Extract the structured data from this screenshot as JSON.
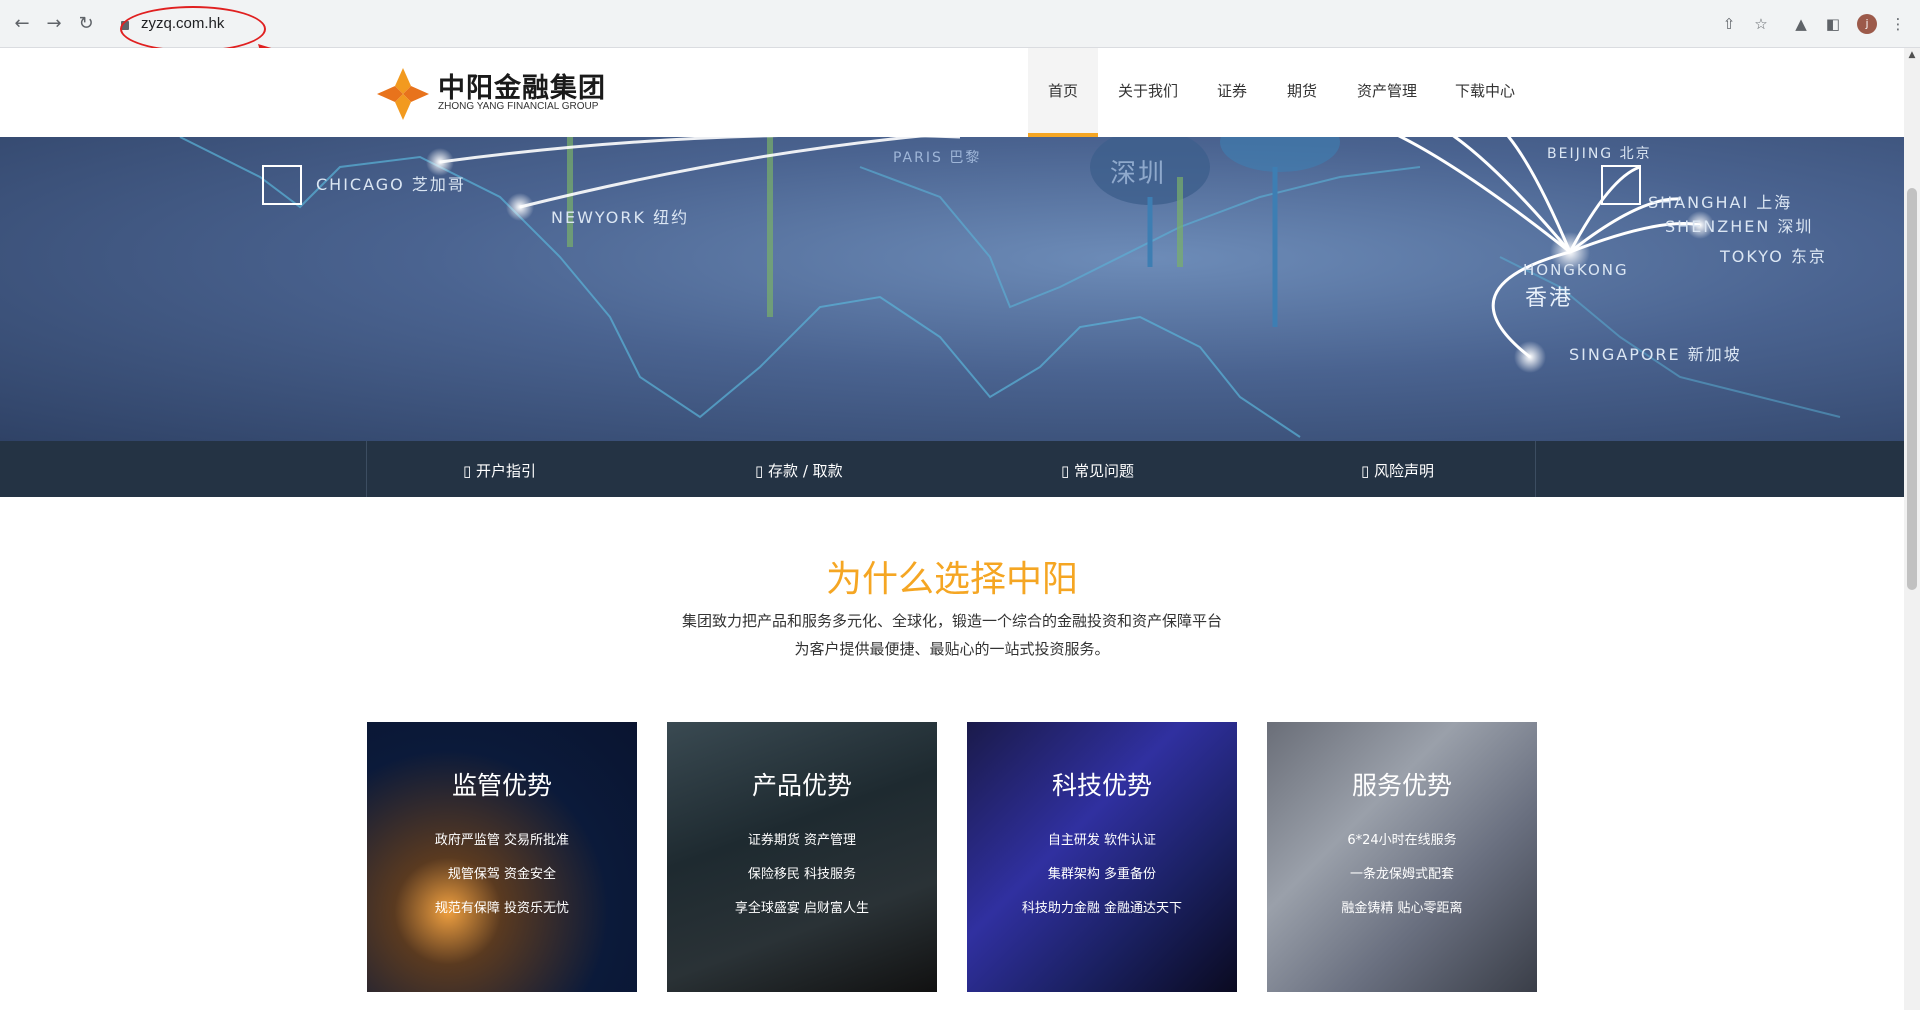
{
  "browser": {
    "url": "zyzq.com.hk",
    "avatar_letter": "j"
  },
  "site": {
    "logo_cn": "中阳金融集团",
    "logo_en": "ZHONG YANG FINANCIAL GROUP",
    "nav": [
      "首页",
      "关于我们",
      "证券",
      "期货",
      "资产管理",
      "下载中心"
    ],
    "accent": "#f5a623"
  },
  "hero": {
    "cities": {
      "chicago": "CHICAGO 芝加哥",
      "newyork": "NEWYORK 纽约",
      "paris": "PARIS 巴黎",
      "shenzhen_big": "深圳",
      "beijing": "BEIJING 北京",
      "shanghai": "SHANGHAI 上海",
      "shenzhen": "SHENZHEN 深圳",
      "tokyo": "TOKYO 东京",
      "hongkong": "HONGKONG",
      "hongkong_cn": "香港",
      "singapore": "SINGAPORE 新加坡"
    },
    "prev_glyph": "",
    "next_glyph": ""
  },
  "quicklinks": [
    "开户指引",
    "存款 / 取款",
    "常见问题",
    "风险声明"
  ],
  "why": {
    "title": "为什么选择中阳",
    "line1": "集团致力把产品和服务多元化、全球化，锻造一个综合的金融投资和资产保障平台",
    "line2": "为客户提供最便捷、最贴心的一站式投资服务。"
  },
  "cards": [
    {
      "title": "监管优势",
      "lines": [
        "政府严监管 交易所批准",
        "规管保驾 资金安全",
        "规范有保障 投资乐无忧"
      ]
    },
    {
      "title": "产品优势",
      "lines": [
        "证券期货 资产管理",
        "保险移民 科技服务",
        "享全球盛宴 启财富人生"
      ]
    },
    {
      "title": "科技优势",
      "lines": [
        "自主研发 软件认证",
        "集群架构 多重备份",
        "科技助力金融 金融通达天下"
      ]
    },
    {
      "title": "服务优势",
      "lines": [
        "6*24小时在线服务",
        "一条龙保姆式配套",
        "融金铸精 贴心零距离"
      ]
    }
  ]
}
